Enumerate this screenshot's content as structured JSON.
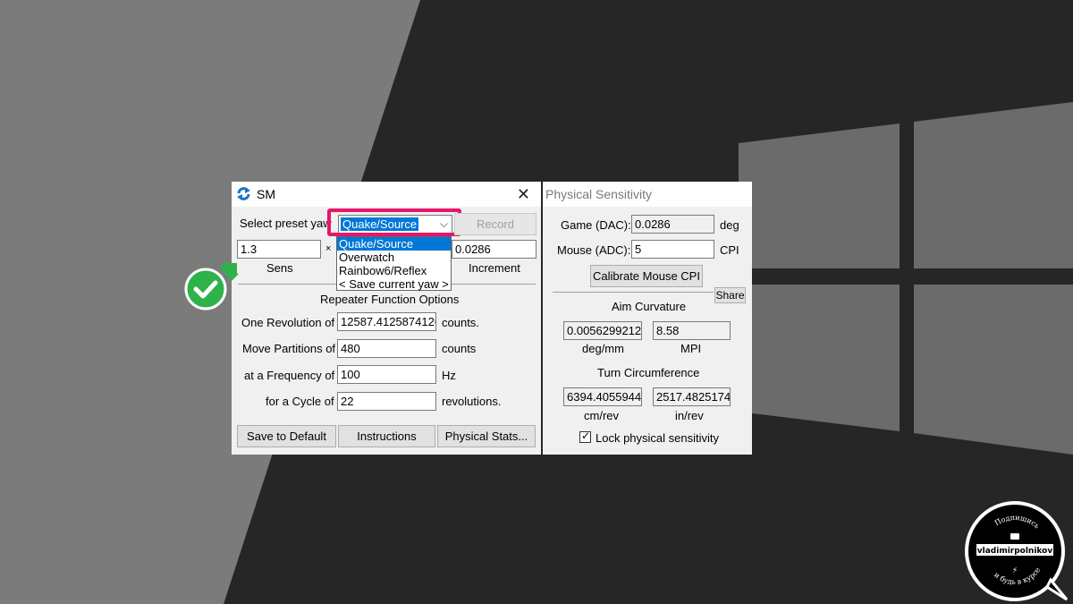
{
  "sm_window": {
    "title": "SM",
    "preset_label": "Select preset yaw",
    "preset_selected": "Quake/Source",
    "preset_options": [
      "Quake/Source",
      "Overwatch",
      "Rainbow6/Reflex",
      "< Save current yaw >"
    ],
    "record_label": "Record",
    "sens_value": "1.3",
    "sens_label": "Sens",
    "multiply_sign": "×",
    "increment_value": "0.0286",
    "increment_label": "Increment",
    "repeater_heading": "Repeater Function Options",
    "rows": [
      {
        "label": "One Revolution of",
        "value": "12587.4125874126",
        "unit": "counts."
      },
      {
        "label": "Move Partitions of",
        "value": "480",
        "unit": "counts"
      },
      {
        "label": "at a Frequency of",
        "value": "100",
        "unit": "Hz"
      },
      {
        "label": "for a Cycle of",
        "value": "22",
        "unit": "revolutions."
      }
    ],
    "buttons": {
      "save_default": "Save to Default",
      "instructions": "Instructions",
      "physical_stats": "Physical Stats..."
    }
  },
  "phys_window": {
    "title": "Physical Sensitivity",
    "game_label": "Game (DAC):",
    "game_value": "0.0286",
    "game_unit": "deg",
    "mouse_label": "Mouse (ADC):",
    "mouse_value": "5",
    "mouse_unit": "CPI",
    "calibrate_label": "Calibrate Mouse CPI",
    "share_label": "Share",
    "aim_heading": "Aim Curvature",
    "aim_value1": "0.0056299212",
    "aim_unit1": "deg/mm",
    "aim_value2": "8.58",
    "aim_unit2": "MPI",
    "turn_heading": "Turn Circumference",
    "turn_value1": "6394.4055944",
    "turn_unit1": "cm/rev",
    "turn_value2": "2517.4825174",
    "turn_unit2": "in/rev",
    "lock_label": "Lock physical sensitivity",
    "lock_checked": true
  },
  "watermark": {
    "name": "vladimirpolnikov",
    "top_text": "Подпишись",
    "bottom_text": "и будь в курсе"
  },
  "colors": {
    "highlight": "#e6176a",
    "select_blue": "#0078d7",
    "check_green": "#2fb24a"
  }
}
